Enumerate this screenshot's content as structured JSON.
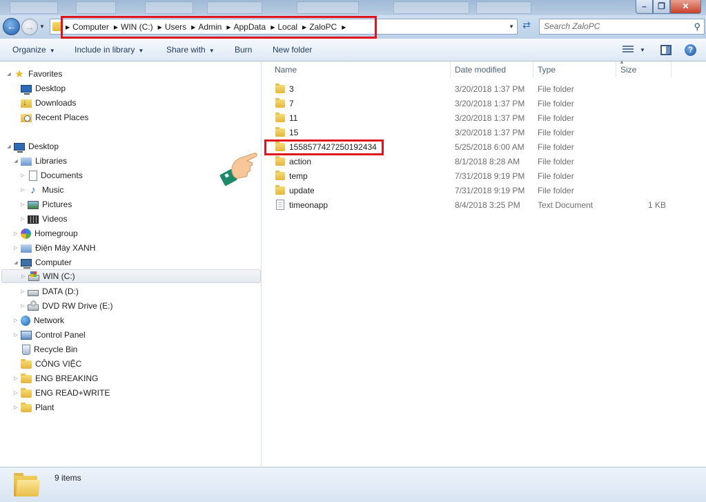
{
  "address": {
    "crumbs": [
      "Computer",
      "WIN (C:)",
      "Users",
      "Admin",
      "AppData",
      "Local",
      "ZaloPC"
    ]
  },
  "search": {
    "placeholder": "Search ZaloPC"
  },
  "toolbar": {
    "organize": "Organize",
    "include_in_library": "Include in library",
    "share_with": "Share with",
    "burn": "Burn",
    "new_folder": "New folder"
  },
  "nav": {
    "favorites": "Favorites",
    "desktop_fav": "Desktop",
    "downloads": "Downloads",
    "recent_places": "Recent Places",
    "desktop": "Desktop",
    "libraries": "Libraries",
    "documents": "Documents",
    "music": "Music",
    "pictures": "Pictures",
    "videos": "Videos",
    "homegroup": "Homegroup",
    "dien_may_xanh": "Điện Máy XANH",
    "computer": "Computer",
    "win_c": "WIN (C:)",
    "data_d": "DATA (D:)",
    "dvd_e": "DVD RW Drive (E:)",
    "network": "Network",
    "control_panel": "Control Panel",
    "recycle_bin": "Recycle Bin",
    "cong_viec": "CÔNG VIỆC",
    "eng_breaking": "ENG BREAKING",
    "eng_read_write": "ENG READ+WRITE",
    "plant": "Plant"
  },
  "columns": {
    "name": "Name",
    "date": "Date modified",
    "type": "Type",
    "size": "Size"
  },
  "files": [
    {
      "name": "3",
      "date": "3/20/2018 1:37 PM",
      "type": "File folder",
      "size": ""
    },
    {
      "name": "7",
      "date": "3/20/2018 1:37 PM",
      "type": "File folder",
      "size": ""
    },
    {
      "name": "11",
      "date": "3/20/2018 1:37 PM",
      "type": "File folder",
      "size": ""
    },
    {
      "name": "15",
      "date": "3/20/2018 1:37 PM",
      "type": "File folder",
      "size": ""
    },
    {
      "name": "1558577427250192434",
      "date": "5/25/2018 6:00 AM",
      "type": "File folder",
      "size": ""
    },
    {
      "name": "action",
      "date": "8/1/2018 8:28 AM",
      "type": "File folder",
      "size": ""
    },
    {
      "name": "temp",
      "date": "7/31/2018 9:19 PM",
      "type": "File folder",
      "size": ""
    },
    {
      "name": "update",
      "date": "7/31/2018 9:19 PM",
      "type": "File folder",
      "size": ""
    },
    {
      "name": "timeonapp",
      "date": "8/4/2018 3:25 PM",
      "type": "Text Document",
      "size": "1 KB"
    }
  ],
  "status": {
    "item_count": "9 items"
  },
  "colors": {
    "highlight_red": "#e0141c",
    "toolbar_text": "#1e395b"
  }
}
